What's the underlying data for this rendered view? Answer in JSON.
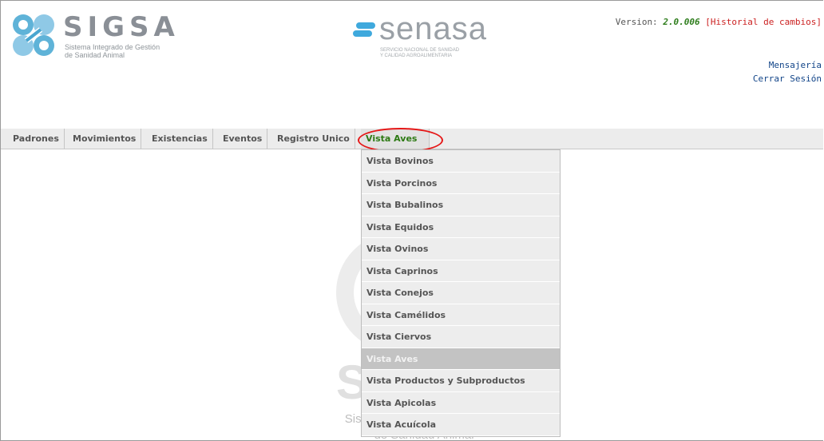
{
  "header": {
    "sigsa_title": "SIGSA",
    "sigsa_subtitle_1": "Sistema Integrado de Gestión",
    "sigsa_subtitle_2": "de Sanidad Animal",
    "senasa_title": "senasa",
    "senasa_subtitle_1": "Servicio Nacional de Sanidad",
    "senasa_subtitle_2": "y Calidad Agroalimentaria",
    "version_label": "Version: ",
    "version_number": "2.0.006",
    "history_link": "[Historial de cambios]",
    "messages_link": "Mensajería",
    "logout_link": "Cerrar Sesión"
  },
  "menu": {
    "items": [
      {
        "label": "Padrones"
      },
      {
        "label": "Movimientos"
      },
      {
        "label": "Existencias"
      },
      {
        "label": "Eventos"
      },
      {
        "label": "Registro Unico"
      },
      {
        "label": "Vista Aves"
      }
    ],
    "active_index": 5
  },
  "dropdown": {
    "items": [
      {
        "label": "Vista Bovinos"
      },
      {
        "label": "Vista Porcinos"
      },
      {
        "label": "Vista Bubalinos"
      },
      {
        "label": "Vista Equidos"
      },
      {
        "label": "Vista Ovinos"
      },
      {
        "label": "Vista Caprinos"
      },
      {
        "label": "Vista Conejos"
      },
      {
        "label": "Vista Camélidos"
      },
      {
        "label": "Vista Ciervos"
      },
      {
        "label": "Vista Aves"
      },
      {
        "label": "Vista Productos y Subproductos"
      },
      {
        "label": "Vista Apicolas"
      },
      {
        "label": "Vista Acuícola"
      }
    ],
    "selected_index": 9
  },
  "watermark": {
    "line1": "Sistema Integrado de Gestión",
    "line2": "de Sanidad Animal"
  },
  "colors": {
    "active_menu_text": "#2d7a14",
    "version_number": "#2e7d1c",
    "history_link": "#cc2222",
    "highlight_ring": "#e51818"
  }
}
